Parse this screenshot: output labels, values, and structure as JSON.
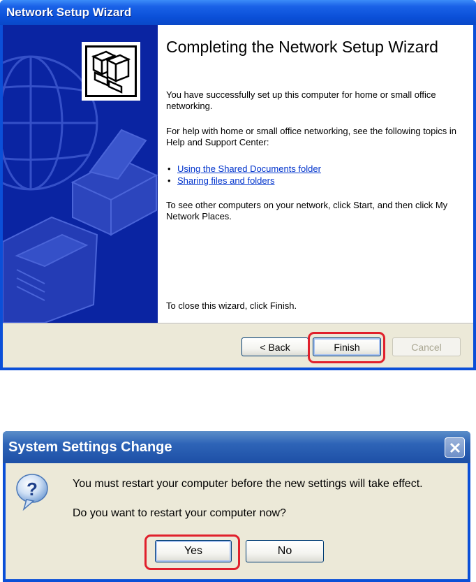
{
  "wizard": {
    "title": "Network Setup Wizard",
    "heading": "Completing the Network Setup Wizard",
    "para1": "You have successfully set up this computer for home or small office networking.",
    "para2": "For help with home or small office networking, see the following topics in Help and Support Center:",
    "links": [
      {
        "label": "Using the Shared Documents folder"
      },
      {
        "label": "Sharing files and folders"
      }
    ],
    "para3": "To see other computers on your network, click Start, and then click My Network Places.",
    "closing": "To close this wizard, click Finish.",
    "buttons": {
      "back": "< Back",
      "finish": "Finish",
      "cancel": "Cancel"
    },
    "side_icon": "networked-computers-icon"
  },
  "dialog": {
    "title": "System Settings Change",
    "message1": "You must restart your computer before the new settings will take effect.",
    "message2": "Do you want to restart your computer now?",
    "buttons": {
      "yes": "Yes",
      "no": "No"
    },
    "icon": "question-icon"
  },
  "colors": {
    "titlebar_blue": "#0a4fd7",
    "side_panel": "#0a24a2",
    "dialog_face": "#ece9d8",
    "highlight_red": "#e0202c",
    "link_blue": "#0033cc"
  }
}
